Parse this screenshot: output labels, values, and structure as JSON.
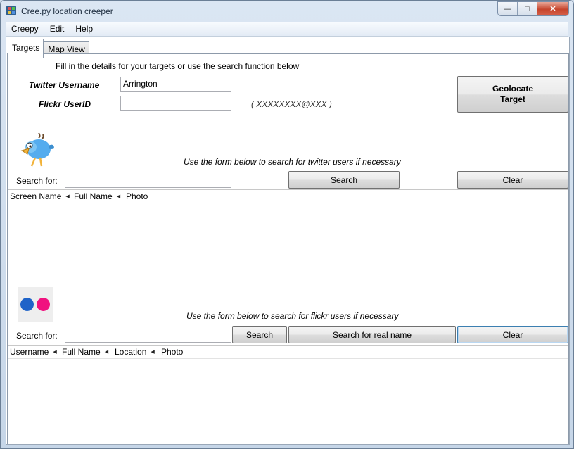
{
  "window": {
    "title": "Cree.py location creeper",
    "minimize_glyph": "—",
    "maximize_glyph": "□",
    "close_glyph": "✕"
  },
  "menu": [
    "Creepy",
    "Edit",
    "Help"
  ],
  "tabs": [
    {
      "label": "Targets",
      "active": true
    },
    {
      "label": "Map View",
      "active": false
    }
  ],
  "targets": {
    "intro": "Fill in the details for your targets or use the search function below",
    "twitter_label": "Twitter Username",
    "twitter_value": "Arrington",
    "flickr_label": "Flickr UserID",
    "flickr_value": "",
    "flickr_hint": "( XXXXXXXX@XXX )",
    "geolocate_line1": "Geolocate",
    "geolocate_line2": "Target"
  },
  "twitter_search": {
    "icon": "twitter-bird-icon",
    "hint": "Use the form below to search for twitter users if necessary",
    "search_label": "Search for:",
    "search_value": "",
    "search_button": "Search",
    "clear_button": "Clear",
    "columns": [
      "Screen Name",
      "Full Name",
      "Photo"
    ],
    "sort_glyph": "◀"
  },
  "flickr_search": {
    "icon": "flickr-logo-icon",
    "hint": "Use the form below to search for flickr users if necessary",
    "search_label": "Search for:",
    "search_value": "",
    "search_button": "Search",
    "realname_button": "Search for real name",
    "clear_button": "Clear",
    "columns": [
      "Username",
      "Full Name",
      "Location",
      "Photo"
    ],
    "sort_glyph": "◀"
  },
  "colors": {
    "flickr_blue": "#1f63c8",
    "flickr_pink": "#f0127f"
  }
}
